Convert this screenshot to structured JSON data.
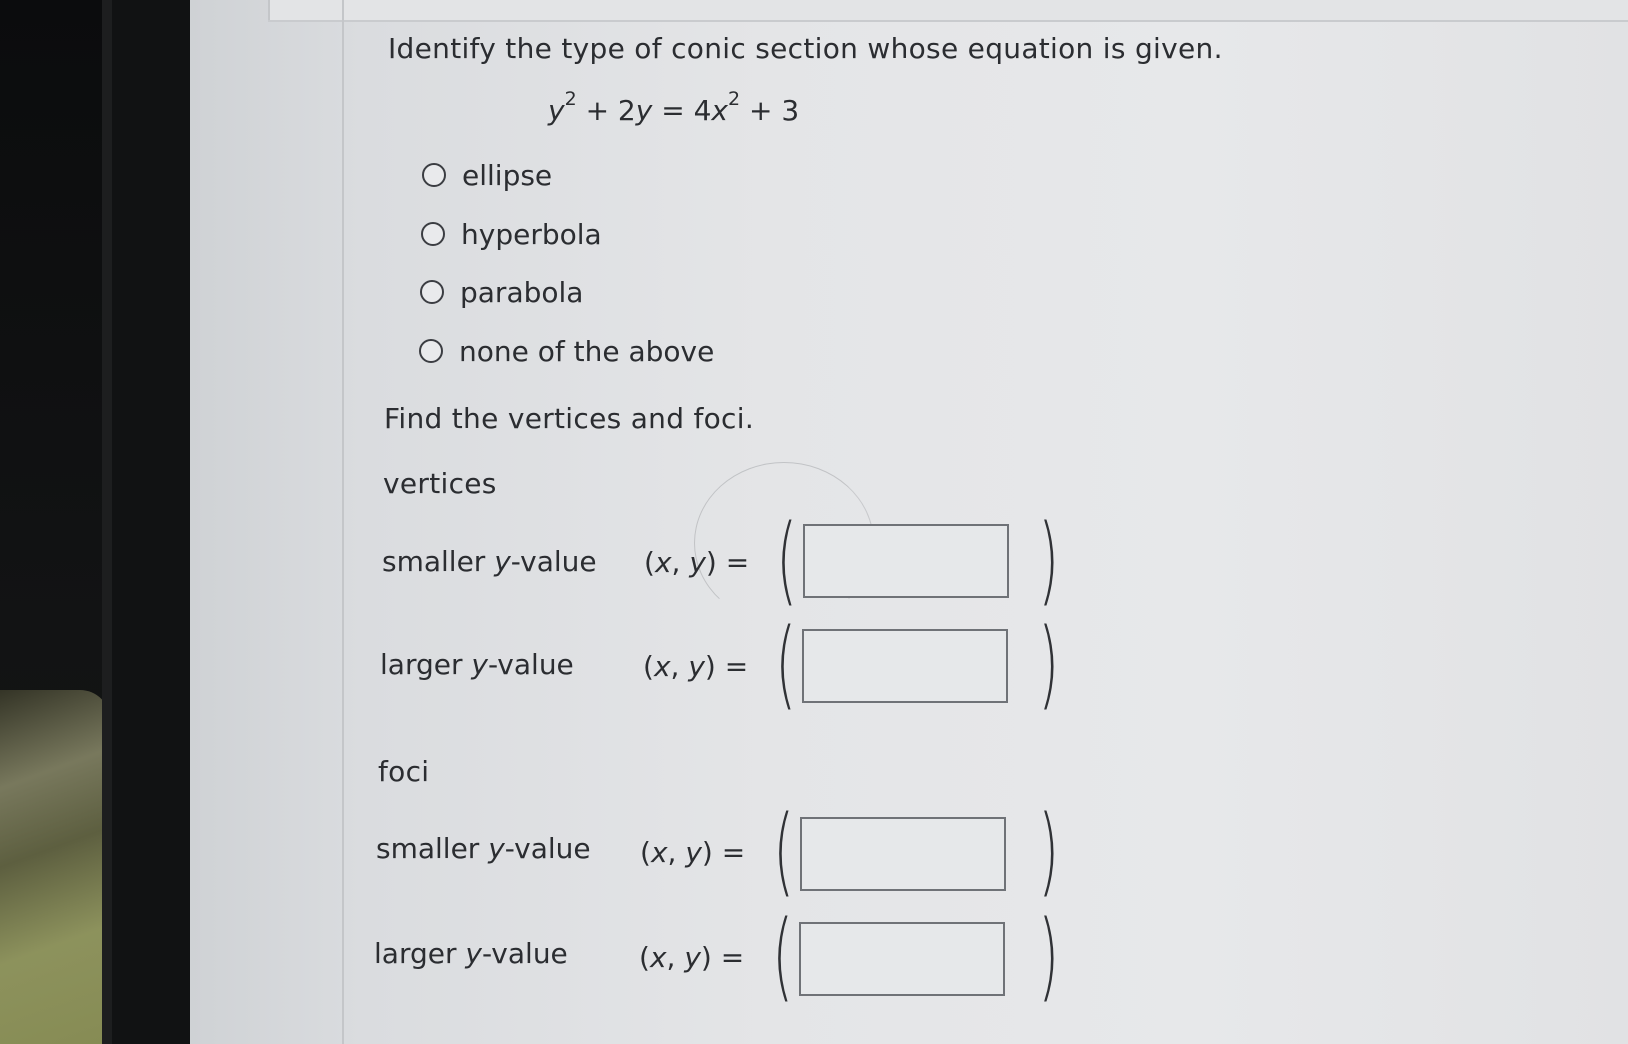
{
  "question": {
    "prompt": "Identify the type of conic section whose equation is given.",
    "equation": {
      "lhs_y": "y",
      "lhs_y_exp": "2",
      "lhs_rest": " + 2",
      "lhs_y2": "y",
      "eq": " = 4",
      "rhs_x": "x",
      "rhs_x_exp": "2",
      "rhs_rest": " + 3"
    },
    "options": [
      "ellipse",
      "hyperbola",
      "parabola",
      "none of the above"
    ],
    "selected": null
  },
  "part2": {
    "prompt": "Find the vertices and foci.",
    "vertices_heading": "vertices",
    "foci_heading": "foci",
    "rows": [
      {
        "prefix": "smaller ",
        "var": "y",
        "suffix": "-value",
        "value": ""
      },
      {
        "prefix": "larger ",
        "var": "y",
        "suffix": "-value",
        "value": ""
      },
      {
        "prefix": "smaller ",
        "var": "y",
        "suffix": "-value",
        "value": ""
      },
      {
        "prefix": "larger ",
        "var": "y",
        "suffix": "-value",
        "value": ""
      }
    ],
    "xy": {
      "open": "(",
      "x": "x",
      "comma": ", ",
      "y": "y",
      "close": ")",
      "eq": " ="
    },
    "paren_open": "(",
    "paren_close": ")"
  }
}
